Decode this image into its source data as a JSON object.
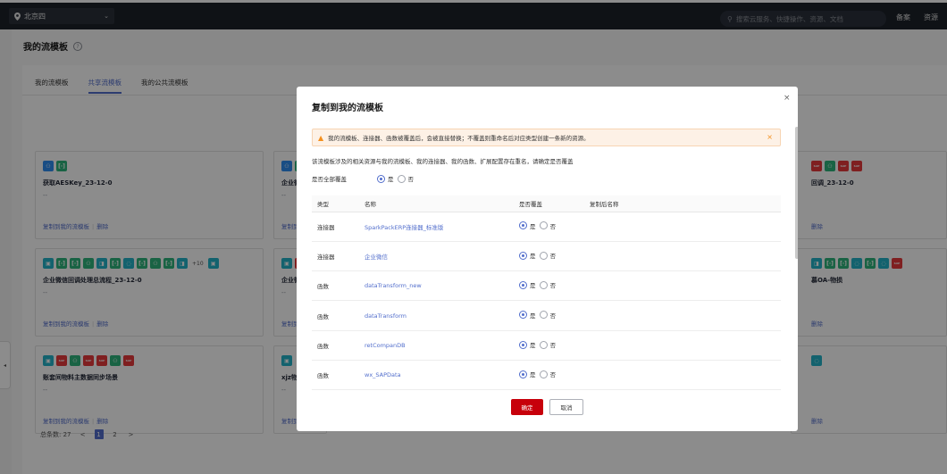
{
  "topbar": {
    "region": "北京四",
    "search_placeholder": "搜索云服务、快捷操作、资源、文档",
    "links": [
      "备案",
      "资源"
    ]
  },
  "page": {
    "title": "我的流模板",
    "help_glyph": "?",
    "tabs": [
      {
        "label": "我的流模板",
        "active": false
      },
      {
        "label": "共享流模板",
        "active": true
      },
      {
        "label": "我的公共流模板",
        "active": false
      }
    ],
    "cards": [
      {
        "name": "获取AESKey_23-12-0",
        "desc": "--",
        "action_copy": "复制到我的流模板",
        "action_delete": "删除"
      },
      {
        "name": "企业微信",
        "desc": "--",
        "action_copy": "复制到"
      },
      {
        "name": "回调_23-12-0",
        "desc": "",
        "action_copy": "删除"
      },
      {
        "name": "企业微信回调处理总流程_23-12-0",
        "desc": "--",
        "action_copy": "复制到我的流模板",
        "action_delete": "删除",
        "more_count": "+10"
      },
      {
        "name": "企业微信",
        "desc": "--",
        "action_copy": "复制到"
      },
      {
        "name": "慕OA-物损",
        "desc": "",
        "action_copy": "删除"
      },
      {
        "name": "账套间物料主数据同步场景",
        "desc": "--",
        "action_copy": "复制到我的流模板",
        "action_delete": "删除"
      },
      {
        "name": "xjz物料",
        "desc": "--",
        "action_copy": "复制到"
      },
      {
        "name": "",
        "desc": "",
        "action_copy": "删除"
      }
    ],
    "pager": {
      "total": "总条数: 27",
      "prev": "<",
      "pages": [
        "1",
        "2"
      ],
      "next": ">"
    }
  },
  "dialog": {
    "title": "复制到我的流模板",
    "close": "×",
    "alert": "我的流模板、连接器、函数被覆盖后，会被直接替换；不覆盖则重命名后对应类型创建一条新的资源。",
    "alert_close": "×",
    "description": "该流模板涉及的相关资源与我的流模板、我的连接器、我的函数、扩展配置存在重名，请确定是否覆盖",
    "overwrite_all_label": "是否全部覆盖",
    "yes": "是",
    "no": "否",
    "columns": [
      "类型",
      "名称",
      "是否覆盖",
      "复制后名称"
    ],
    "rows": [
      {
        "type": "连接器",
        "name": "SparkPackERP连接器_标准版",
        "overwrite": "是"
      },
      {
        "type": "连接器",
        "name": "企业微信",
        "overwrite": "是"
      },
      {
        "type": "函数",
        "name": "dataTransform_new",
        "overwrite": "是"
      },
      {
        "type": "函数",
        "name": "dataTransform",
        "overwrite": "是"
      },
      {
        "type": "函数",
        "name": "retCompanDB",
        "overwrite": "是"
      },
      {
        "type": "函数",
        "name": "wx_SAPData",
        "overwrite": "是"
      }
    ],
    "ok": "确定",
    "cancel": "取消"
  },
  "colors": {
    "accent": "#526ecc",
    "primary_button": "#c7000b",
    "alert_bg": "#fdf1e6"
  }
}
